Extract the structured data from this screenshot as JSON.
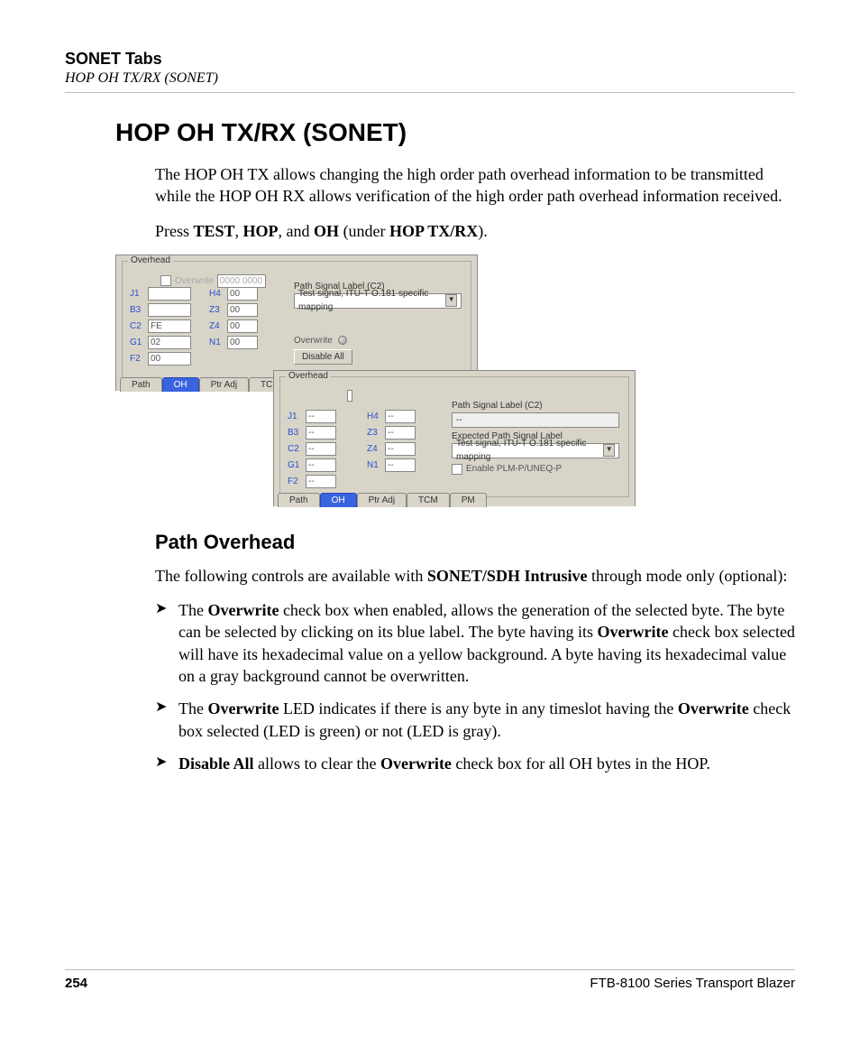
{
  "header": {
    "chapter": "SONET Tabs",
    "section_running": "HOP OH TX/RX (SONET)"
  },
  "title": "HOP OH TX/RX (SONET)",
  "intro": "The HOP OH TX allows changing the high order path overhead information to be transmitted while the HOP OH RX allows verification of the high order path overhead information received.",
  "press_line_prefix": "Press ",
  "press_bold1": "TEST",
  "press_sep1": ", ",
  "press_bold2": "HOP",
  "press_sep2": ", and ",
  "press_bold3": "OH",
  "press_mid": " (under ",
  "press_bold4": "HOP TX/RX",
  "press_end": ").",
  "subsection": "Path Overhead",
  "para2_a": "The following controls are available with ",
  "para2_b": "SONET/SDH Intrusive",
  "para2_c": " through mode only (optional):",
  "bullets": {
    "b1_a": "The ",
    "b1_b": "Overwrite",
    "b1_c": " check box when enabled, allows the generation of the selected byte. The byte can be selected by clicking on its blue label. The byte having its ",
    "b1_d": "Overwrite",
    "b1_e": " check box selected will have its hexadecimal value on a yellow background. A byte having its hexadecimal value on a gray background cannot be overwritten.",
    "b2_a": "The ",
    "b2_b": "Overwrite",
    "b2_c": " LED indicates if there is any byte in any timeslot having the ",
    "b2_d": "Overwrite",
    "b2_e": " check box selected (LED is green) or not (LED is gray).",
    "b3_a": "Disable All",
    "b3_b": " allows to clear the ",
    "b3_c": "Overwrite",
    "b3_d": " check box for all OH bytes in the HOP."
  },
  "footer": {
    "page": "254",
    "product": "FTB-8100 Series Transport Blazer"
  },
  "panel1": {
    "legend": "Overhead",
    "overwrite_label": "Overwrite",
    "overwrite_default": "0000 0000",
    "bytes_left": [
      {
        "label": "J1",
        "value": ""
      },
      {
        "label": "B3",
        "value": ""
      },
      {
        "label": "C2",
        "value": "FE"
      },
      {
        "label": "G1",
        "value": "02"
      },
      {
        "label": "F2",
        "value": "00"
      }
    ],
    "bytes_right": [
      {
        "label": "H4",
        "value": "00"
      },
      {
        "label": "Z3",
        "value": "00"
      },
      {
        "label": "Z4",
        "value": "00"
      },
      {
        "label": "N1",
        "value": "00"
      }
    ],
    "psl_label": "Path Signal Label (C2)",
    "psl_value": "Test signal, ITU-T O.181 specific mapping",
    "overwrite_led_label": "Overwrite",
    "disable_all": "Disable All",
    "tabs": [
      "Path",
      "OH",
      "Ptr Adj",
      "TCM"
    ],
    "active_tab": 1
  },
  "panel2": {
    "legend": "Overhead",
    "bytes_left": [
      {
        "label": "J1",
        "value": "--"
      },
      {
        "label": "B3",
        "value": "--"
      },
      {
        "label": "C2",
        "value": "--"
      },
      {
        "label": "G1",
        "value": "--"
      },
      {
        "label": "F2",
        "value": "--"
      }
    ],
    "bytes_right": [
      {
        "label": "H4",
        "value": "--"
      },
      {
        "label": "Z3",
        "value": "--"
      },
      {
        "label": "Z4",
        "value": "--"
      },
      {
        "label": "N1",
        "value": "--"
      }
    ],
    "psl_label": "Path Signal Label (C2)",
    "psl_value": "--",
    "expected_label": "Expected Path Signal Label",
    "expected_value": "Test signal, ITU-T O.181 specific mapping",
    "enable_plm_label": "Enable PLM-P/UNEQ-P",
    "tabs": [
      "Path",
      "OH",
      "Ptr Adj",
      "TCM",
      "PM"
    ],
    "active_tab": 1
  }
}
